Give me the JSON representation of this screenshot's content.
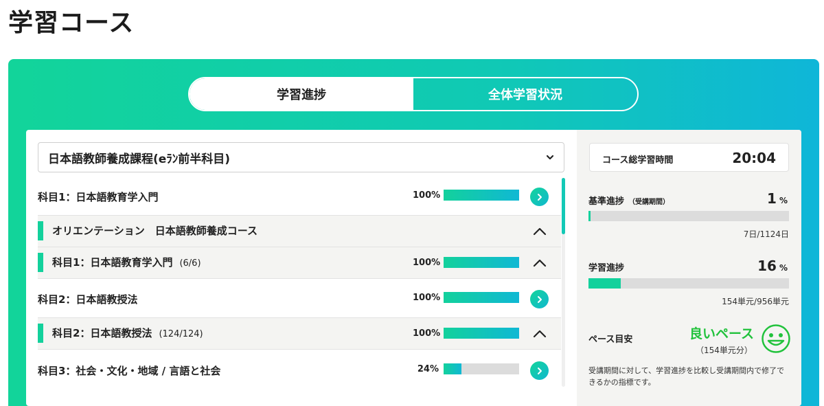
{
  "page": {
    "title": "学習コース"
  },
  "tabs": [
    {
      "label": "学習進捗",
      "active": true
    },
    {
      "label": "全体学習状況",
      "active": false
    }
  ],
  "course_select": {
    "value": "日本語教師養成課程(eﾗﾝ前半科目)"
  },
  "rows": [
    {
      "label": "科目1：日本語教育学入門",
      "count": "",
      "percent": "100%",
      "progress": 1.0,
      "type": "course",
      "action": "go"
    },
    {
      "label": "オリエンテーション　日本語教師養成コース",
      "count": "",
      "percent": "",
      "progress": null,
      "type": "sub",
      "action": "collapse"
    },
    {
      "label": "科目1：日本語教育学入門",
      "count": "(6/6)",
      "percent": "100%",
      "progress": 1.0,
      "type": "sub",
      "action": "collapse"
    },
    {
      "label": "科目2：日本語教授法",
      "count": "",
      "percent": "100%",
      "progress": 1.0,
      "type": "course",
      "action": "go"
    },
    {
      "label": "科目2：日本語教授法",
      "count": "(124/124)",
      "percent": "100%",
      "progress": 1.0,
      "type": "sub",
      "action": "collapse"
    },
    {
      "label": "科目3：社会・文化・地域 / 言語と社会",
      "count": "",
      "percent": "24%",
      "progress": 0.24,
      "type": "course",
      "action": "go"
    }
  ],
  "summary": {
    "total_time_label": "コース総学習時間",
    "total_time_value": "20:04",
    "standard": {
      "label": "基準進捗",
      "sub_label": "（受講期間）",
      "value": "1",
      "unit": "%",
      "progress": 0.01,
      "note": "7日/1124日"
    },
    "study": {
      "label": "学習進捗",
      "value": "16",
      "unit": "%",
      "progress": 0.16,
      "note": "154単元/956単元"
    },
    "pace": {
      "label": "ペース目安",
      "value": "良いペース",
      "sub": "（154単元分）",
      "icon": "smile-icon",
      "description": "受講期間に対して、学習進捗を比較し受講期間内で修了できるかの指標です。"
    }
  },
  "colors": {
    "accent": "#13d19c",
    "accent_blue": "#10b8d4",
    "good": "#21c23c"
  }
}
